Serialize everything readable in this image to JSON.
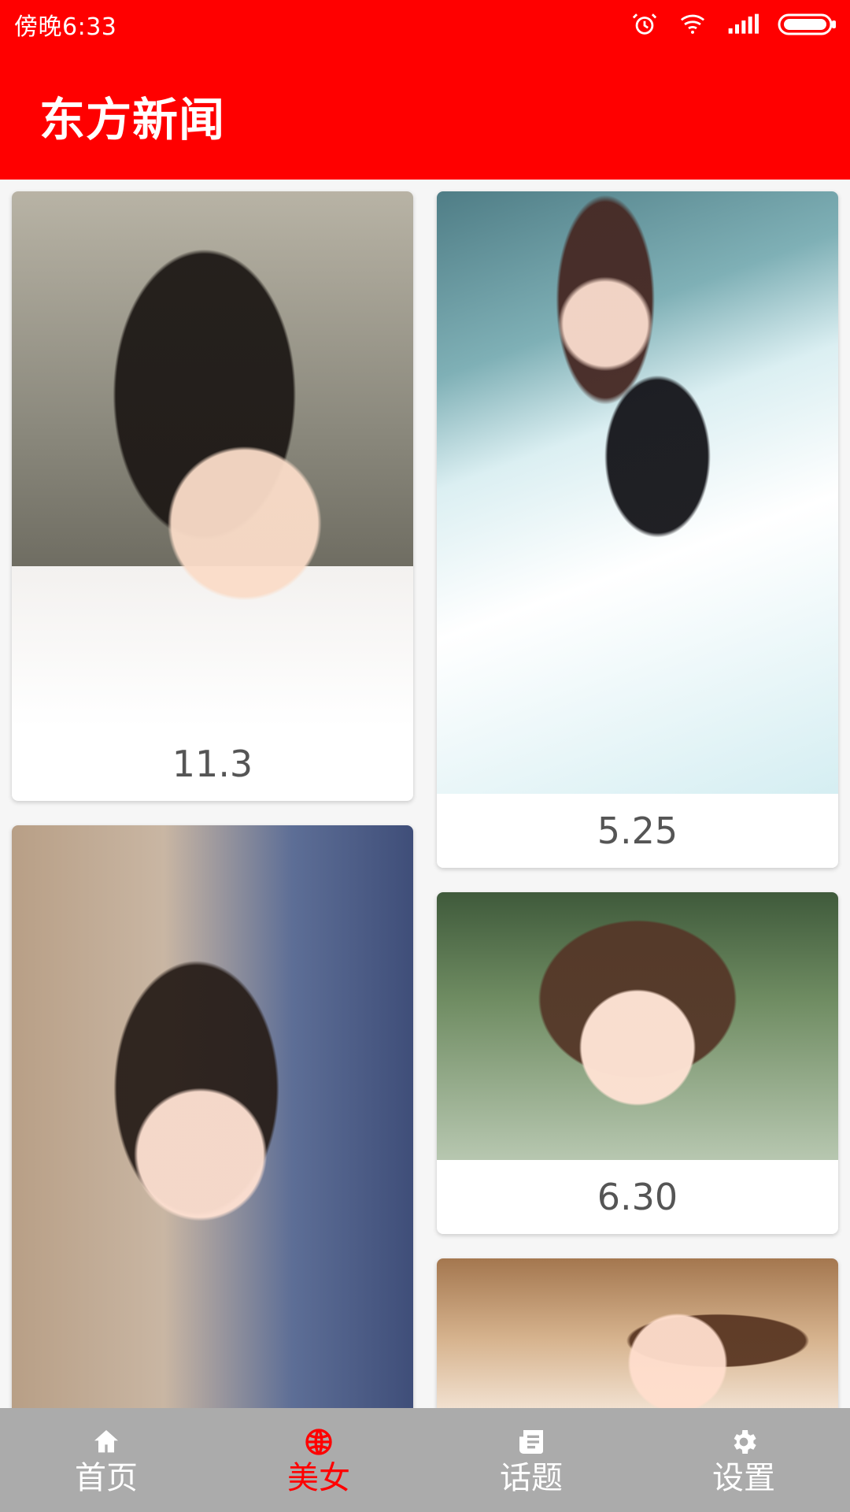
{
  "status_bar": {
    "time": "傍晚6:33",
    "icons": [
      "alarm-icon",
      "wifi-icon",
      "signal-icon",
      "battery-icon"
    ]
  },
  "app": {
    "title": "东方新闻",
    "brand_color": "#ff0000"
  },
  "gallery": {
    "cards": [
      {
        "caption": "11.3"
      },
      {
        "caption": "5.25"
      },
      {
        "caption": "6.30"
      },
      {
        "caption": ""
      },
      {
        "caption": ""
      }
    ]
  },
  "bottom_nav": {
    "active_color": "#ff0000",
    "tabs": [
      {
        "label": "首页",
        "icon": "home-icon",
        "active": false
      },
      {
        "label": "美女",
        "icon": "globe-icon",
        "active": true
      },
      {
        "label": "话题",
        "icon": "news-icon",
        "active": false
      },
      {
        "label": "设置",
        "icon": "gear-icon",
        "active": false
      }
    ]
  }
}
